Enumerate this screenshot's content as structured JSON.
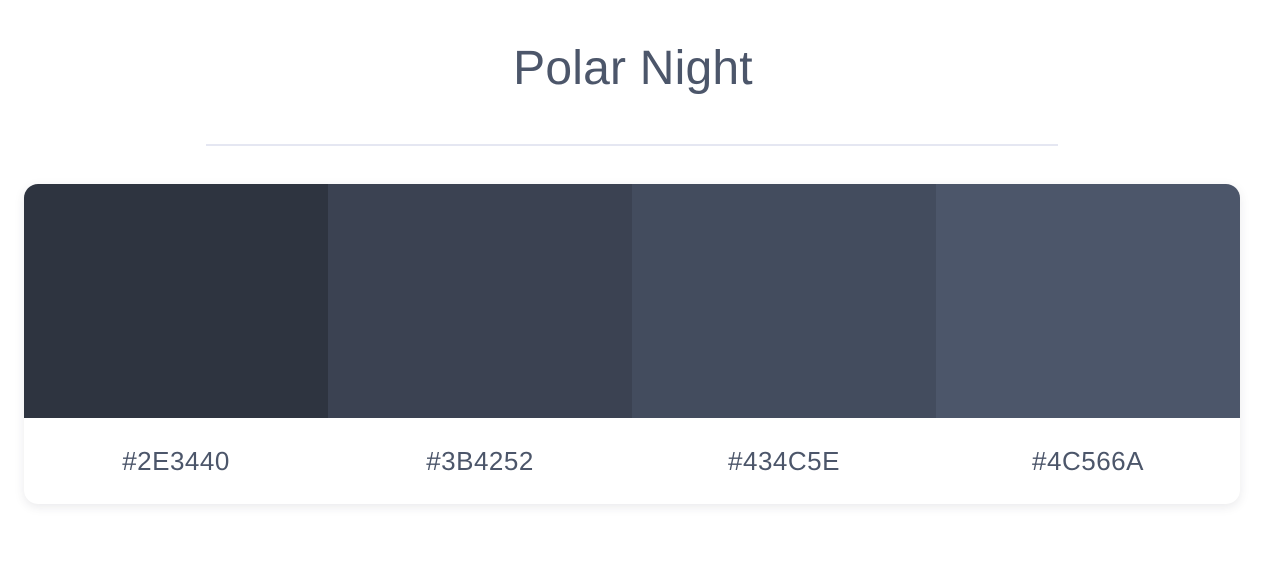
{
  "title": "Polar Night",
  "swatches": [
    {
      "hex": "#2E3440",
      "label": "#2E3440"
    },
    {
      "hex": "#3B4252",
      "label": "#3B4252"
    },
    {
      "hex": "#434C5E",
      "label": "#434C5E"
    },
    {
      "hex": "#4C566A",
      "label": "#4C566A"
    }
  ]
}
